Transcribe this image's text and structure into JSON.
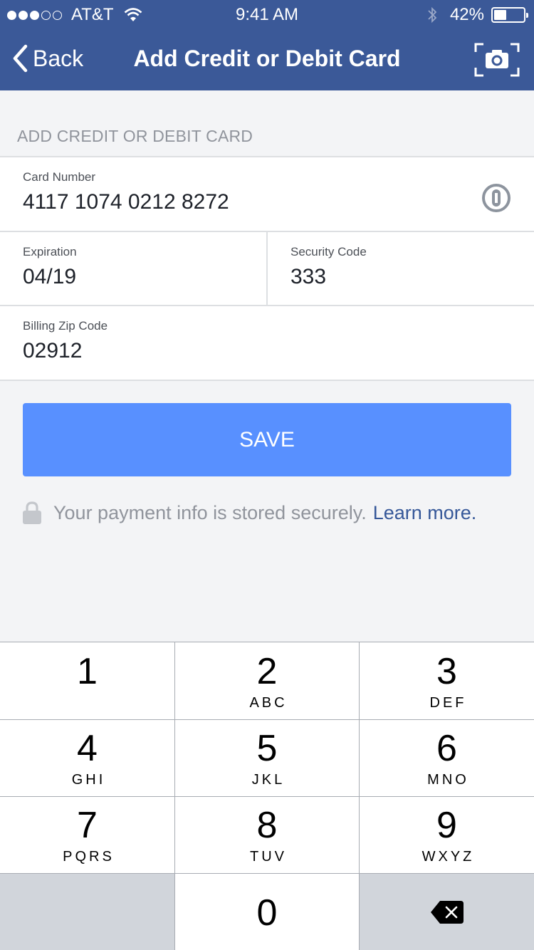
{
  "status_bar": {
    "carrier": "AT&T",
    "signal_bars_filled": 3,
    "signal_bars_total": 5,
    "time": "9:41 AM",
    "battery_percent": "42%",
    "battery_level": 0.42
  },
  "nav": {
    "back_label": "Back",
    "title": "Add Credit or Debit Card",
    "right_icon": "camera-scan-icon"
  },
  "section_header": "ADD CREDIT OR DEBIT CARD",
  "form": {
    "card_number": {
      "label": "Card Number",
      "value": "4117 1074 0212 8272",
      "trailing_icon": "password-manager-icon"
    },
    "expiration": {
      "label": "Expiration",
      "value": "04/19"
    },
    "security_code": {
      "label": "Security Code",
      "value": "333"
    },
    "billing_zip": {
      "label": "Billing Zip Code",
      "value": "02912"
    }
  },
  "save_button": "SAVE",
  "secure_note": {
    "text": "Your payment info is stored securely.",
    "link": "Learn more."
  },
  "keypad": {
    "keys": [
      {
        "digit": "1",
        "letters": ""
      },
      {
        "digit": "2",
        "letters": "ABC"
      },
      {
        "digit": "3",
        "letters": "DEF"
      },
      {
        "digit": "4",
        "letters": "GHI"
      },
      {
        "digit": "5",
        "letters": "JKL"
      },
      {
        "digit": "6",
        "letters": "MNO"
      },
      {
        "digit": "7",
        "letters": "PQRS"
      },
      {
        "digit": "8",
        "letters": "TUV"
      },
      {
        "digit": "9",
        "letters": "WXYZ"
      },
      {
        "digit": "0",
        "letters": ""
      }
    ],
    "delete_icon": "backspace-icon"
  },
  "colors": {
    "nav_background": "#3b5998",
    "save_button": "#5890ff",
    "link": "#365899",
    "page_background": "#f3f4f6"
  }
}
